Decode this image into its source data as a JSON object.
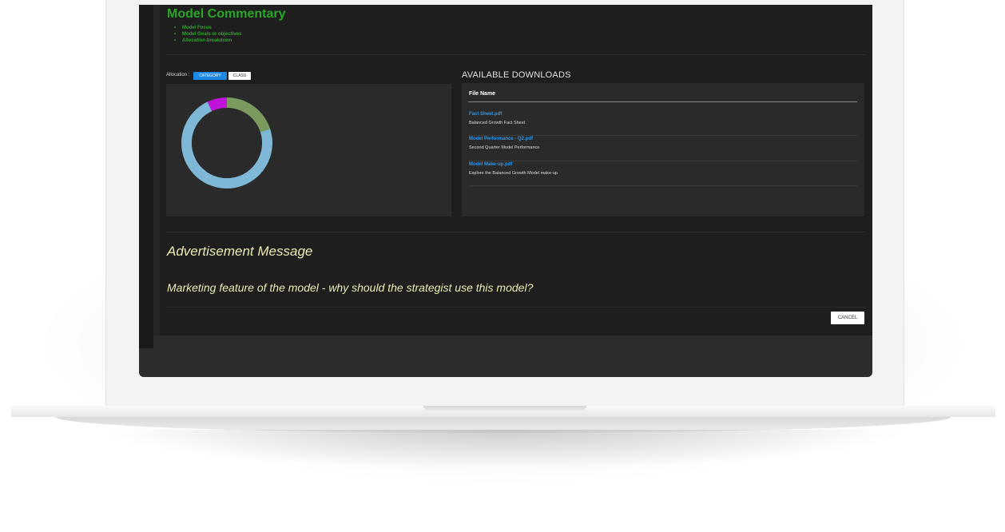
{
  "commentary": {
    "title": "Model Commentary",
    "items": [
      "Model Focus",
      "Model Goals or objectives",
      "Allocation breakdown"
    ]
  },
  "allocation": {
    "label": "Allocation :",
    "options": [
      "CATEGORY",
      "CLASS"
    ],
    "selected": "CATEGORY"
  },
  "chart_data": {
    "type": "pie",
    "style": "donut",
    "categories": [
      "",
      "",
      ""
    ],
    "values": [
      20,
      73,
      7
    ],
    "colors": [
      "#7a9a5e",
      "#7fb7d6",
      "#c012d8"
    ],
    "start_angle_deg": 0,
    "direction": "clockwise",
    "center_color": "#2a2a2a"
  },
  "downloads": {
    "title": "AVAILABLE DOWNLOADS",
    "header": "File Name",
    "files": [
      {
        "name": "Fact Sheet.pdf",
        "description": "Balanced Growth Fact Sheet"
      },
      {
        "name": "Model Performance - Q2.pdf",
        "description": "Second Quarter Model Performance"
      },
      {
        "name": "Model Make-up.pdf",
        "description": "Explore the Balanced Growth Model make-up"
      }
    ]
  },
  "advertisement": {
    "title": "Advertisement Message",
    "body": "Marketing feature of the model - why should the strategist use this model?"
  },
  "actions": {
    "cancel": "CANCEL"
  },
  "colors": {
    "screen_background": "#1e1e1e",
    "commentary_green": "#2aa52a",
    "link_blue": "#2f96e6",
    "active_toggle": "#1e88e5",
    "ad_text": "#ecebb3"
  }
}
